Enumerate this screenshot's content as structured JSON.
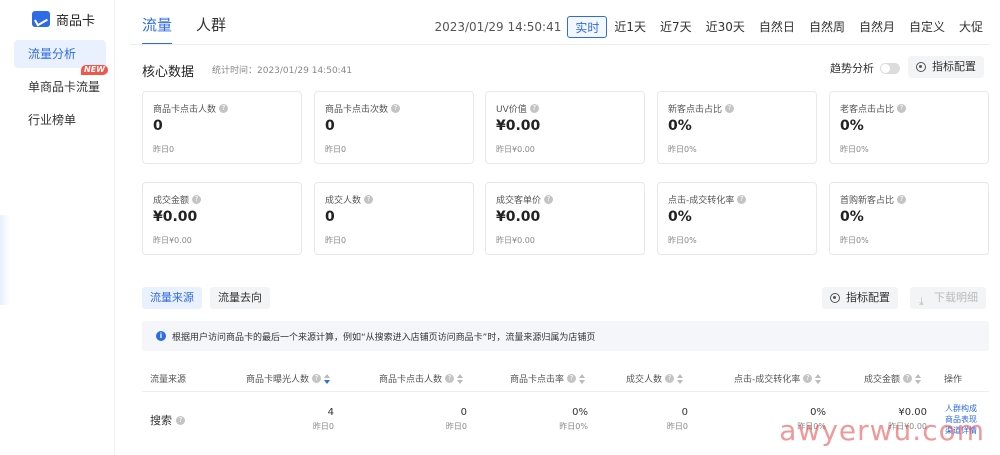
{
  "sidebar": {
    "brand": "商品卡",
    "items": [
      {
        "label": "流量分析"
      },
      {
        "label": "单商品卡流量",
        "badge": "NEW"
      },
      {
        "label": "行业榜单"
      }
    ]
  },
  "top_tabs": [
    "流量",
    "人群"
  ],
  "time": {
    "timestamp": "2023/01/29 14:50:41",
    "ranges": [
      "实时",
      "近1天",
      "近7天",
      "近30天",
      "自然日",
      "自然周",
      "自然月",
      "自定义",
      "大促"
    ]
  },
  "core": {
    "title": "核心数据",
    "subtitle": "统计时间：2023/01/29 14:50:41",
    "trend_label": "趋势分析",
    "config_button": "指标配置"
  },
  "cards": [
    {
      "label": "商品卡点击人数",
      "value": "0",
      "yday": "昨日0"
    },
    {
      "label": "商品卡点击次数",
      "value": "0",
      "yday": "昨日0"
    },
    {
      "label": "UV价值",
      "value": "¥0.00",
      "yday": "昨日¥0.00"
    },
    {
      "label": "新客点击占比",
      "value": "0%",
      "yday": "昨日0%"
    },
    {
      "label": "老客点击占比",
      "value": "0%",
      "yday": "昨日0%"
    },
    {
      "label": "成交金额",
      "value": "¥0.00",
      "yday": "昨日¥0.00"
    },
    {
      "label": "成交人数",
      "value": "0",
      "yday": "昨日0"
    },
    {
      "label": "成交客单价",
      "value": "¥0.00",
      "yday": "昨日¥0.00"
    },
    {
      "label": "点击-成交转化率",
      "value": "0%",
      "yday": "昨日0%"
    },
    {
      "label": "首购新客占比",
      "value": "0%",
      "yday": "昨日0%"
    }
  ],
  "source": {
    "tabs": [
      "流量来源",
      "流量去向"
    ],
    "config_button": "指标配置",
    "download_button": "下载明细",
    "info": "根据用户访问商品卡的最后一个来源计算，例如“从搜索进入店铺页访问商品卡”时，流量来源归属为店铺页"
  },
  "table": {
    "headers": [
      "流量来源",
      "商品卡曝光人数",
      "商品卡点击人数",
      "商品卡点击率",
      "成交人数",
      "点击-成交转化率",
      "成交金额",
      "操作"
    ],
    "row": {
      "name": "搜索",
      "cells": [
        {
          "v": "4",
          "y": "昨日0"
        },
        {
          "v": "0",
          "y": "昨日0"
        },
        {
          "v": "0%",
          "y": "昨日0%"
        },
        {
          "v": "0",
          "y": "昨日0"
        },
        {
          "v": "0%",
          "y": "昨日0%"
        },
        {
          "v": "¥0.00",
          "y": "昨日¥0.00"
        }
      ],
      "ops": [
        "人群构成",
        "商品表现",
        "渠道详情"
      ]
    }
  },
  "watermark": "awyerwu.com"
}
